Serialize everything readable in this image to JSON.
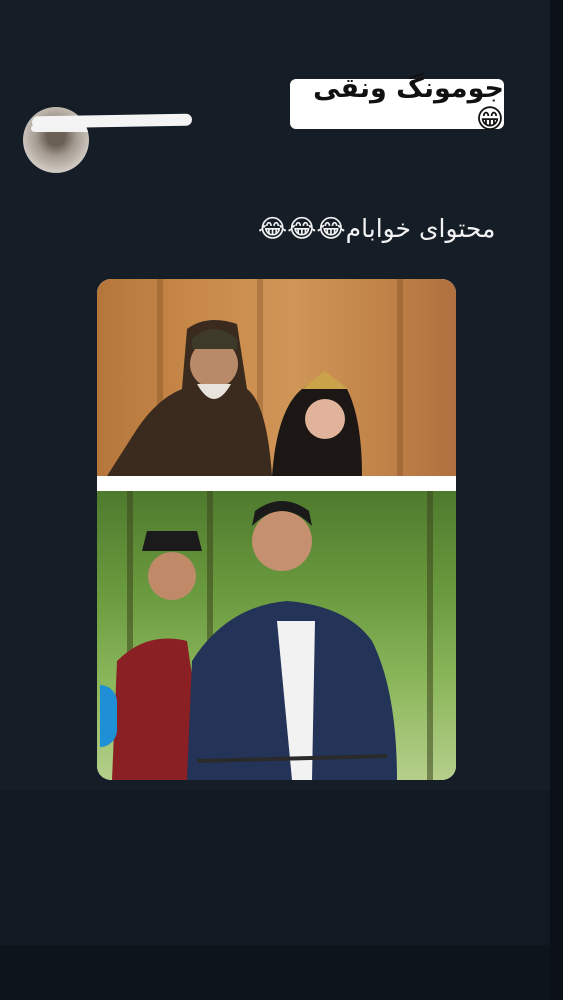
{
  "story": {
    "sticker_text": "جومونگ ونقی😁",
    "caption_text": "محتوای خوابام😂😂😂"
  },
  "photo": {
    "top_scene": "two costumed actors in front of a sandstone wall",
    "bottom_scene": "two actors riding a bicycle through a green forest"
  },
  "colors": {
    "background": "#151d27",
    "sticker_bg": "#ffffff",
    "caption_text": "#f2f2f2",
    "badge": "#1f8fd6"
  }
}
